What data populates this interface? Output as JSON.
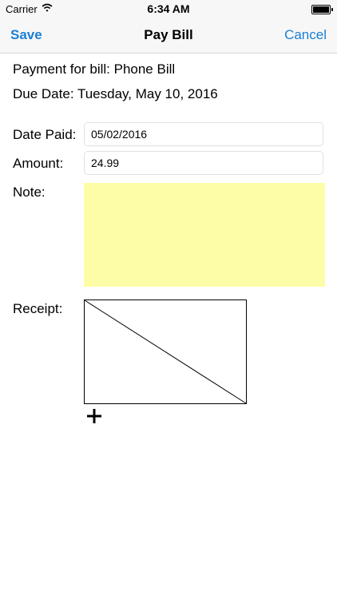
{
  "status_bar": {
    "carrier": "Carrier",
    "time": "6:34 AM"
  },
  "nav": {
    "save_label": "Save",
    "title": "Pay Bill",
    "cancel_label": "Cancel"
  },
  "form": {
    "payment_for": "Payment for bill: Phone Bill",
    "due_date": "Due Date: Tuesday, May 10, 2016",
    "date_paid_label": "Date Paid:",
    "date_paid_value": "05/02/2016",
    "amount_label": "Amount:",
    "amount_value": "24.99",
    "note_label": "Note:",
    "note_value": "",
    "receipt_label": "Receipt:"
  },
  "colors": {
    "accent": "#1a7fd4",
    "note_background": "#fdfda7"
  },
  "icons": {
    "wifi": "wifi-icon",
    "battery": "battery-icon",
    "receipt_placeholder": "empty-image-placeholder",
    "add": "plus-icon"
  }
}
